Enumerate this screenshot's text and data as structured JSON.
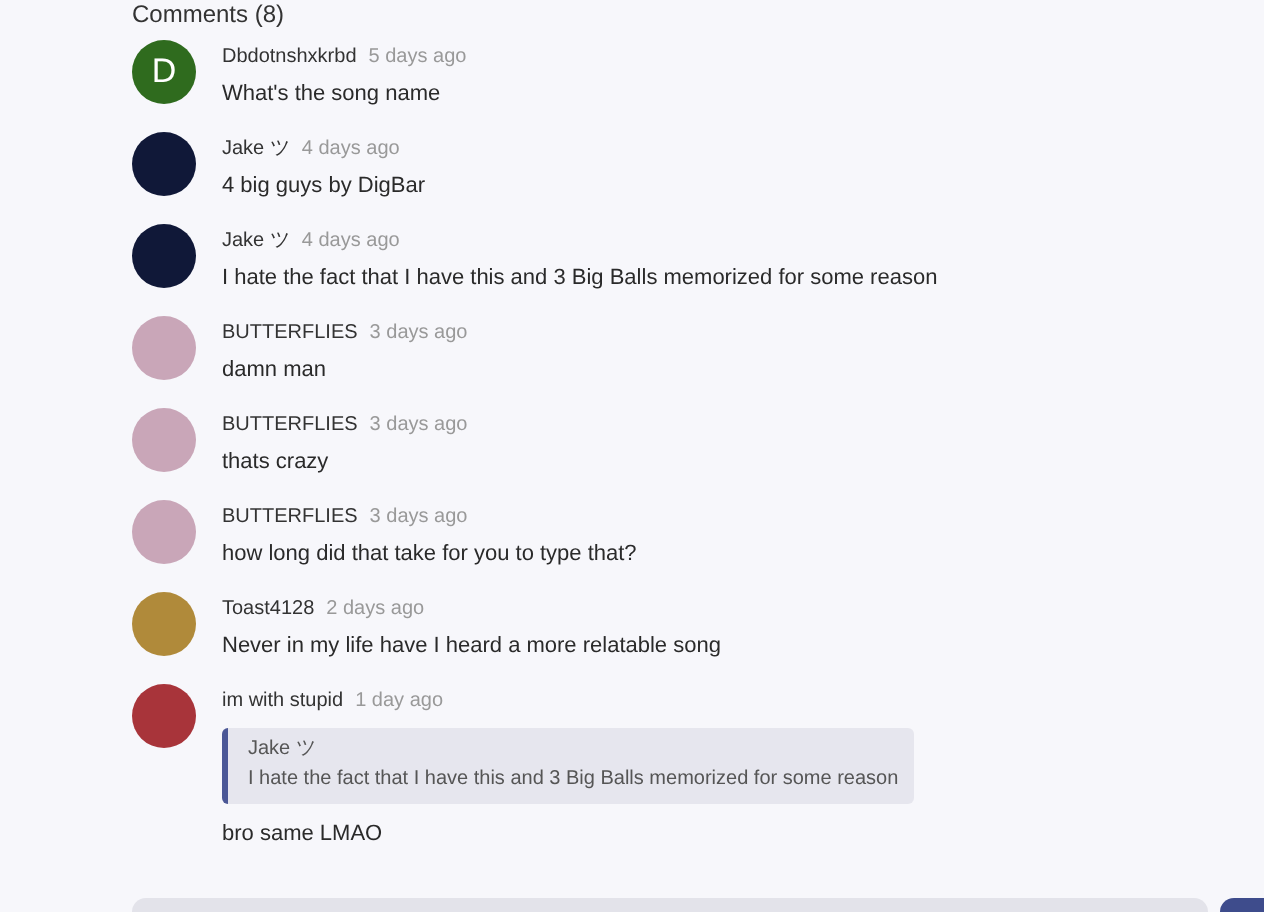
{
  "heading": "Comments (8)",
  "comments": [
    {
      "author": "Dbdotnshxkrbd",
      "time": "5 days ago",
      "text": "What's the song name",
      "avatar": {
        "kind": "letter",
        "letter": "D",
        "color": "#2f6b1e"
      }
    },
    {
      "author": "Jake ツ",
      "time": "4 days ago",
      "text": "4 big guys by DigBar",
      "avatar": {
        "kind": "image",
        "color": "#101838"
      }
    },
    {
      "author": "Jake ツ",
      "time": "4 days ago",
      "text": "I hate the fact that I have this and 3 Big Balls memorized for some reason",
      "avatar": {
        "kind": "image",
        "color": "#101838"
      }
    },
    {
      "author": "BUTTERFLIES",
      "time": "3 days ago",
      "text": "damn man",
      "avatar": {
        "kind": "image",
        "color": "#c9a6b8"
      }
    },
    {
      "author": "BUTTERFLIES",
      "time": "3 days ago",
      "text": "thats crazy",
      "avatar": {
        "kind": "image",
        "color": "#c9a6b8"
      }
    },
    {
      "author": "BUTTERFLIES",
      "time": "3 days ago",
      "text": "how long did that take for you to type that?",
      "avatar": {
        "kind": "image",
        "color": "#c9a6b8"
      }
    },
    {
      "author": "Toast4128",
      "time": "2 days ago",
      "text": "Never in my life have I heard a more relatable song",
      "avatar": {
        "kind": "image",
        "color": "#b08a3a"
      }
    },
    {
      "author": "im with stupid",
      "time": "1 day ago",
      "quote": {
        "author": "Jake ツ",
        "text": "I hate the fact that I have this and 3 Big Balls memorized for some reason"
      },
      "text": "bro same LMAO",
      "avatar": {
        "kind": "image",
        "color": "#a8343a"
      }
    }
  ]
}
